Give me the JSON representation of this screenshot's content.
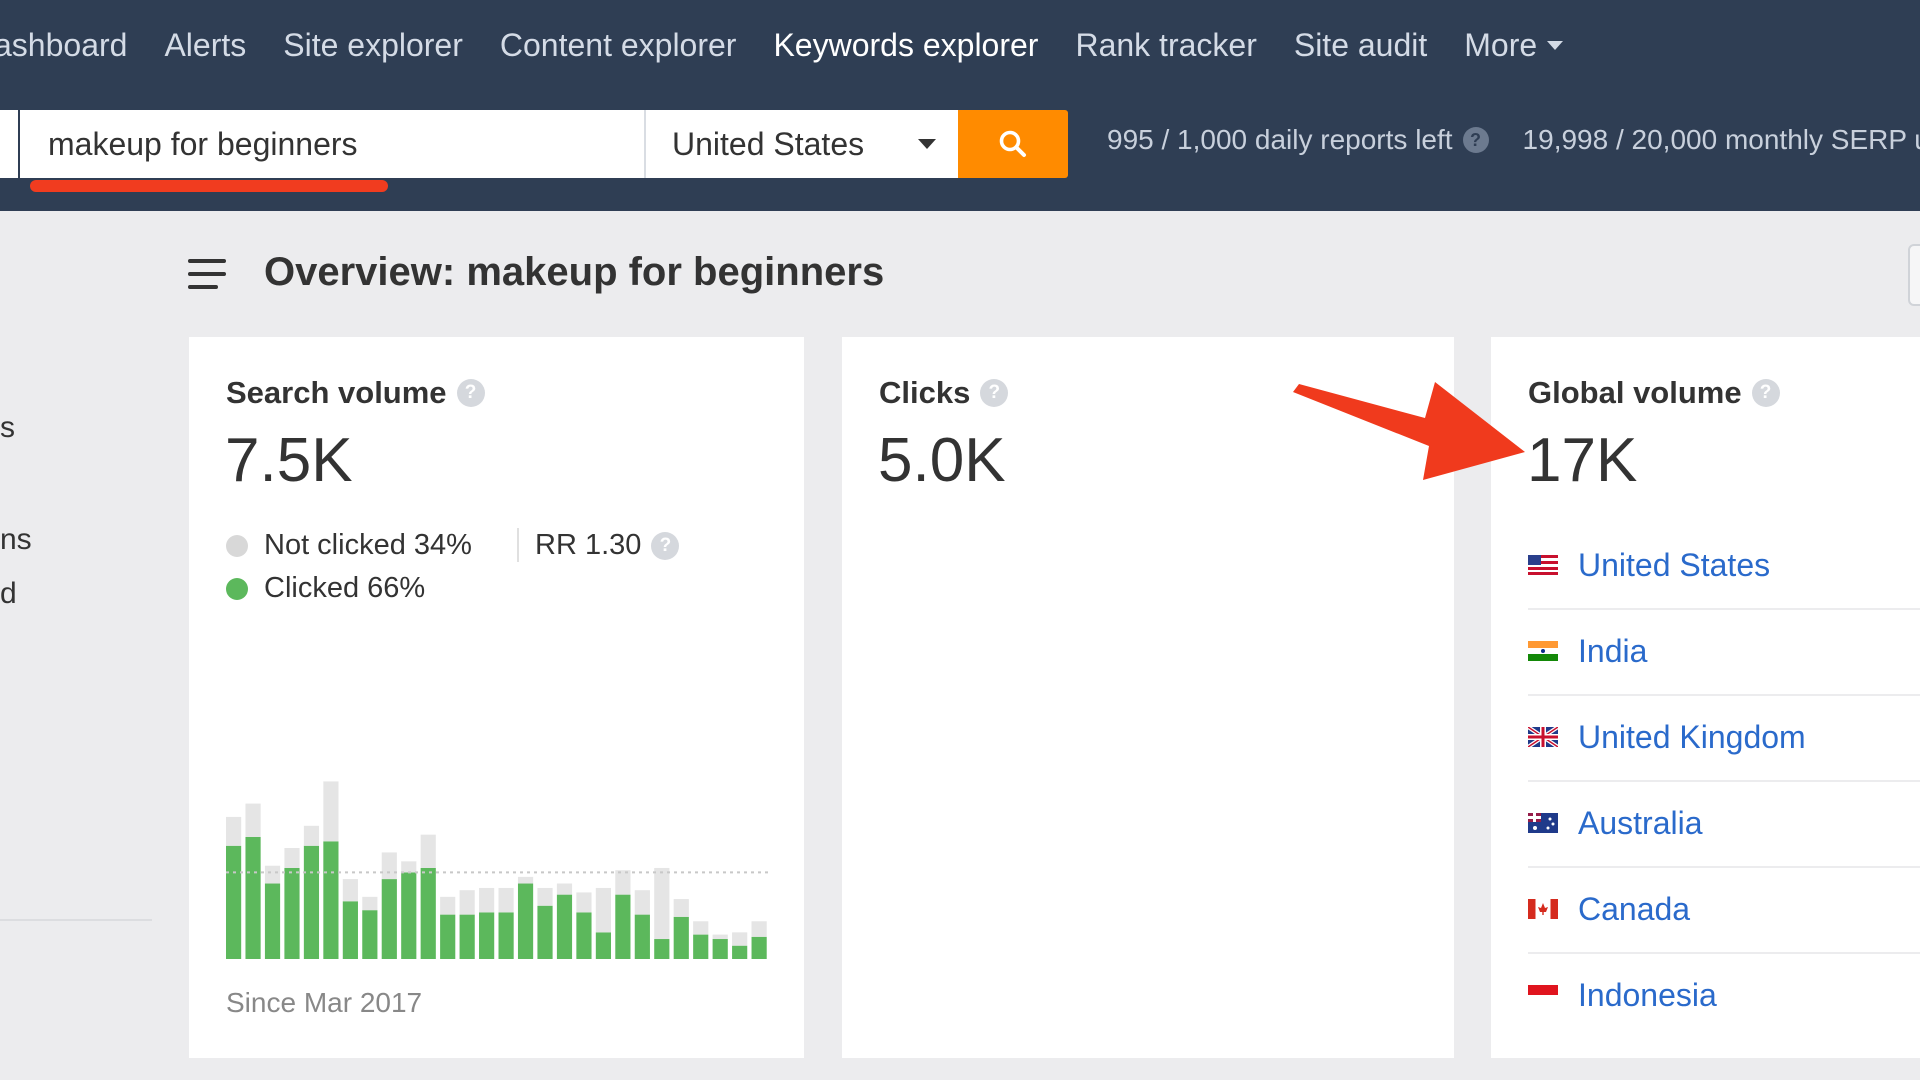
{
  "nav": {
    "items": [
      "ashboard",
      "Alerts",
      "Site explorer",
      "Content explorer",
      "Keywords explorer",
      "Rank tracker",
      "Site audit"
    ],
    "active": "Keywords explorer",
    "more_label": "More"
  },
  "search": {
    "query": "makeup for beginners",
    "country": "United States",
    "daily_reports": "995 / 1,000 daily reports left",
    "monthly_serp": "19,998 / 20,000 monthly SERP u"
  },
  "sidebar_fragments": [
    "s",
    "ns",
    "d"
  ],
  "overview": {
    "title": "Overview: makeup for beginners"
  },
  "search_volume": {
    "label": "Search volume",
    "value": "7.5K",
    "not_clicked": "Not clicked 34%",
    "clicked": "Clicked 66%",
    "rr": "RR 1.30",
    "since": "Since Mar 2017",
    "colors": {
      "clicked": "#5cb85c",
      "not_clicked": "#e5e5e5"
    }
  },
  "clicks": {
    "label": "Clicks",
    "value": "5.0K"
  },
  "global_volume": {
    "label": "Global volume",
    "value": "17K",
    "countries": [
      {
        "name": "United States",
        "flag": "us-flag-icon"
      },
      {
        "name": "India",
        "flag": "india-flag-icon"
      },
      {
        "name": "United Kingdom",
        "flag": "uk-flag-icon"
      },
      {
        "name": "Australia",
        "flag": "australia-flag-icon"
      },
      {
        "name": "Canada",
        "flag": "canada-flag-icon"
      },
      {
        "name": "Indonesia",
        "flag": "indonesia-flag-icon"
      }
    ]
  },
  "chart_data": {
    "type": "bar",
    "stacked": true,
    "series": [
      {
        "values": [
          5.1,
          5.5,
          3.4,
          4.1,
          5.1,
          5.3,
          2.6,
          2.2,
          3.6,
          3.9,
          4.1,
          2.0,
          2.0,
          2.1,
          2.1,
          3.4,
          2.4,
          2.9,
          2.1,
          1.2,
          2.9,
          2.0,
          0.9,
          1.9,
          1.1,
          0.9,
          0.6,
          1.0
        ]
      },
      {
        "values": [
          1.3,
          1.5,
          0.8,
          0.9,
          0.9,
          2.7,
          1.0,
          0.6,
          1.2,
          0.5,
          1.5,
          0.8,
          1.1,
          1.1,
          1.1,
          0.3,
          0.8,
          0.5,
          0.9,
          2.0,
          1.1,
          1.1,
          3.2,
          0.8,
          0.6,
          0.2,
          0.6,
          0.7
        ]
      }
    ],
    "reference_line": 3.9,
    "ylim": [
      0,
      10
    ]
  }
}
